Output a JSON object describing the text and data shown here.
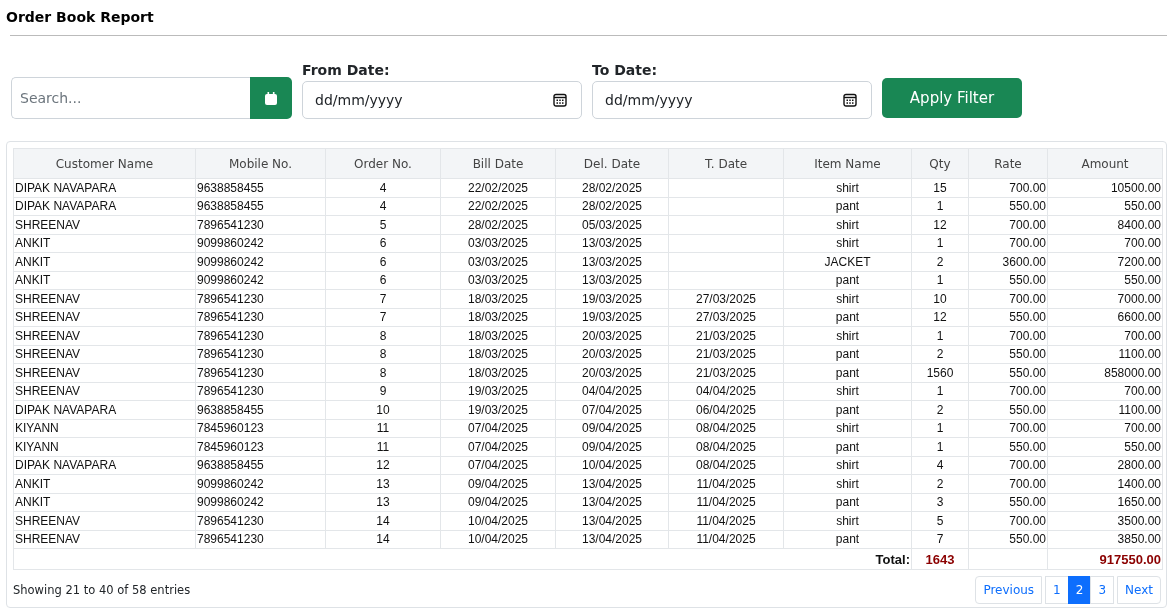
{
  "title": "Order Book Report",
  "search": {
    "placeholder": "Search..."
  },
  "filters": [
    {
      "label": "From Date:",
      "placeholder": "dd/mm/yyyy"
    },
    {
      "label": "To Date:",
      "placeholder": "dd/mm/yyyy"
    }
  ],
  "apply_button": "Apply Filter",
  "table": {
    "columns": [
      "Customer Name",
      "Mobile No.",
      "Order No.",
      "Bill Date",
      "Del. Date",
      "T. Date",
      "Item Name",
      "Qty",
      "Rate",
      "Amount"
    ],
    "rows": [
      [
        "DIPAK NAVAPARA",
        "9638858455",
        "4",
        "22/02/2025",
        "28/02/2025",
        "",
        "shirt",
        "15",
        "700.00",
        "10500.00"
      ],
      [
        "DIPAK NAVAPARA",
        "9638858455",
        "4",
        "22/02/2025",
        "28/02/2025",
        "",
        "pant",
        "1",
        "550.00",
        "550.00"
      ],
      [
        "SHREENAV",
        "7896541230",
        "5",
        "28/02/2025",
        "05/03/2025",
        "",
        "shirt",
        "12",
        "700.00",
        "8400.00"
      ],
      [
        "ANKIT",
        "9099860242",
        "6",
        "03/03/2025",
        "13/03/2025",
        "",
        "shirt",
        "1",
        "700.00",
        "700.00"
      ],
      [
        "ANKIT",
        "9099860242",
        "6",
        "03/03/2025",
        "13/03/2025",
        "",
        "JACKET",
        "2",
        "3600.00",
        "7200.00"
      ],
      [
        "ANKIT",
        "9099860242",
        "6",
        "03/03/2025",
        "13/03/2025",
        "",
        "pant",
        "1",
        "550.00",
        "550.00"
      ],
      [
        "SHREENAV",
        "7896541230",
        "7",
        "18/03/2025",
        "19/03/2025",
        "27/03/2025",
        "shirt",
        "10",
        "700.00",
        "7000.00"
      ],
      [
        "SHREENAV",
        "7896541230",
        "7",
        "18/03/2025",
        "19/03/2025",
        "27/03/2025",
        "pant",
        "12",
        "550.00",
        "6600.00"
      ],
      [
        "SHREENAV",
        "7896541230",
        "8",
        "18/03/2025",
        "20/03/2025",
        "21/03/2025",
        "shirt",
        "1",
        "700.00",
        "700.00"
      ],
      [
        "SHREENAV",
        "7896541230",
        "8",
        "18/03/2025",
        "20/03/2025",
        "21/03/2025",
        "pant",
        "2",
        "550.00",
        "1100.00"
      ],
      [
        "SHREENAV",
        "7896541230",
        "8",
        "18/03/2025",
        "20/03/2025",
        "21/03/2025",
        "pant",
        "1560",
        "550.00",
        "858000.00"
      ],
      [
        "SHREENAV",
        "7896541230",
        "9",
        "19/03/2025",
        "04/04/2025",
        "04/04/2025",
        "shirt",
        "1",
        "700.00",
        "700.00"
      ],
      [
        "DIPAK NAVAPARA",
        "9638858455",
        "10",
        "19/03/2025",
        "07/04/2025",
        "06/04/2025",
        "pant",
        "2",
        "550.00",
        "1100.00"
      ],
      [
        "KIYANN",
        "7845960123",
        "11",
        "07/04/2025",
        "09/04/2025",
        "08/04/2025",
        "shirt",
        "1",
        "700.00",
        "700.00"
      ],
      [
        "KIYANN",
        "7845960123",
        "11",
        "07/04/2025",
        "09/04/2025",
        "08/04/2025",
        "pant",
        "1",
        "550.00",
        "550.00"
      ],
      [
        "DIPAK NAVAPARA",
        "9638858455",
        "12",
        "07/04/2025",
        "10/04/2025",
        "08/04/2025",
        "shirt",
        "4",
        "700.00",
        "2800.00"
      ],
      [
        "ANKIT",
        "9099860242",
        "13",
        "09/04/2025",
        "13/04/2025",
        "11/04/2025",
        "shirt",
        "2",
        "700.00",
        "1400.00"
      ],
      [
        "ANKIT",
        "9099860242",
        "13",
        "09/04/2025",
        "13/04/2025",
        "11/04/2025",
        "pant",
        "3",
        "550.00",
        "1650.00"
      ],
      [
        "SHREENAV",
        "7896541230",
        "14",
        "10/04/2025",
        "13/04/2025",
        "11/04/2025",
        "shirt",
        "5",
        "700.00",
        "3500.00"
      ],
      [
        "SHREENAV",
        "7896541230",
        "14",
        "10/04/2025",
        "13/04/2025",
        "11/04/2025",
        "pant",
        "7",
        "550.00",
        "3850.00"
      ]
    ],
    "total": {
      "label": "Total:",
      "qty": "1643",
      "amount": "917550.00"
    }
  },
  "entries_info": "Showing 21 to 40 of 58 entries",
  "pagination": [
    {
      "label": "Previous",
      "selected": false
    },
    {
      "label": "1",
      "selected": false
    },
    {
      "label": "2",
      "selected": true
    },
    {
      "label": "3",
      "selected": false
    },
    {
      "label": "Next",
      "selected": false
    }
  ]
}
